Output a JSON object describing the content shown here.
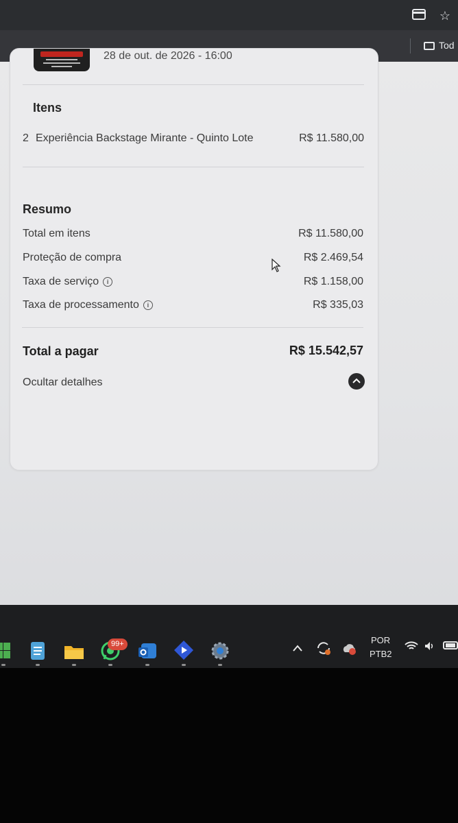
{
  "browser": {
    "bookmark_folder_label": "Tod",
    "icons": [
      "tab-search-icon",
      "star-icon",
      "folder-icon"
    ]
  },
  "event": {
    "date": "28 de out. de 2026 - 16:00"
  },
  "items_section": {
    "title": "Itens",
    "items": [
      {
        "quantity": "2",
        "name": "Experiência Backstage Mirante - Quinto Lote",
        "price": "R$ 11.580,00"
      }
    ]
  },
  "summary": {
    "title": "Resumo",
    "rows": [
      {
        "label": "Total em itens",
        "value": "R$ 11.580,00",
        "info": false
      },
      {
        "label": "Proteção de compra",
        "value": "R$ 2.469,54",
        "info": false
      },
      {
        "label": "Taxa de serviço",
        "value": "R$ 1.158,00",
        "info": true
      },
      {
        "label": "Taxa de processamento",
        "value": "R$ 335,03",
        "info": true
      }
    ],
    "total_label": "Total a pagar",
    "total_value": "R$ 15.542,57",
    "toggle_label": "Ocultar detalhes"
  },
  "taskbar": {
    "apps": [
      "start-icon",
      "notepad-icon",
      "file-explorer-icon",
      "whatsapp-icon",
      "outlook-icon",
      "media-player-icon",
      "settings-icon"
    ],
    "whatsapp_badge": "99+",
    "language_line1": "POR",
    "language_line2": "PTB2"
  },
  "colors": {
    "total_text": "#1f1f1f",
    "badge": "#d84a3a",
    "taskbar": "#1d1e20"
  }
}
